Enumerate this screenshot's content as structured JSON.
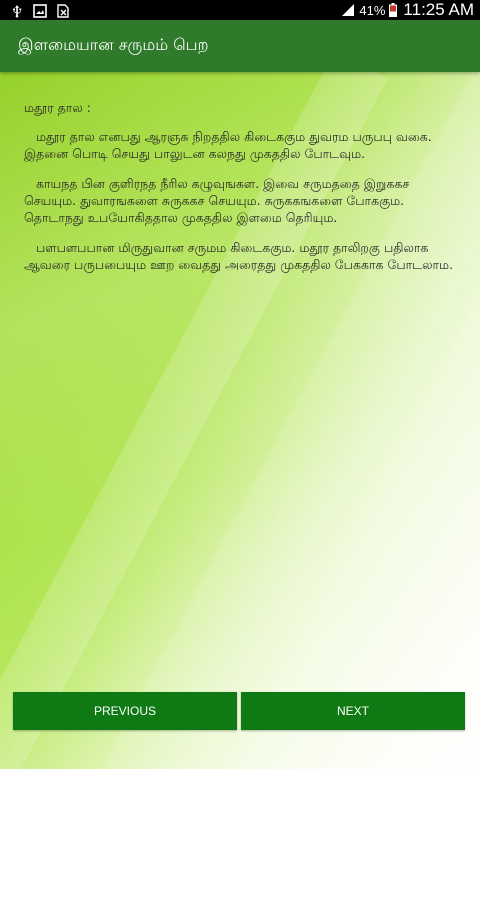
{
  "status_bar": {
    "battery_percent": "41%",
    "time": "11:25 AM",
    "icons": [
      "usb-icon",
      "image-icon",
      "file-icon",
      "signal-icon",
      "battery-icon"
    ]
  },
  "app_bar": {
    "title": "இளமையான சருமம் பெற",
    "background_color": "#2f7b2b"
  },
  "content": {
    "heading": "மதூர தால :",
    "paragraphs": [
      "மதூர தால எனபது ஆரஞசு நிறததில கிடைககும துவரம பருபபு வகை. இதனை பொடி செயது பாலுடன கலநது முகததில போடவும.",
      "காயநத பின குளிரநத நீரில கழுவுஙகள. இவை சருமததை இறுககச செயயும. துவாரஙகளை சுருககச செயயும. சுருககஙகளை போககும. தொடாநது உபயோகிததால முகததில இளமை தெரியும.",
      "பளபளபபான மிருதுவான சருமம கிடைககும. மதூர தாலிறகு பதிலாக ஆவரை பருபபையும ஊற வைதது அரைதது முகததில பேககாக போடலாம."
    ]
  },
  "buttons": {
    "previous_label": "PREVIOUS",
    "next_label": "NEXT",
    "color": "#0f7a14"
  }
}
